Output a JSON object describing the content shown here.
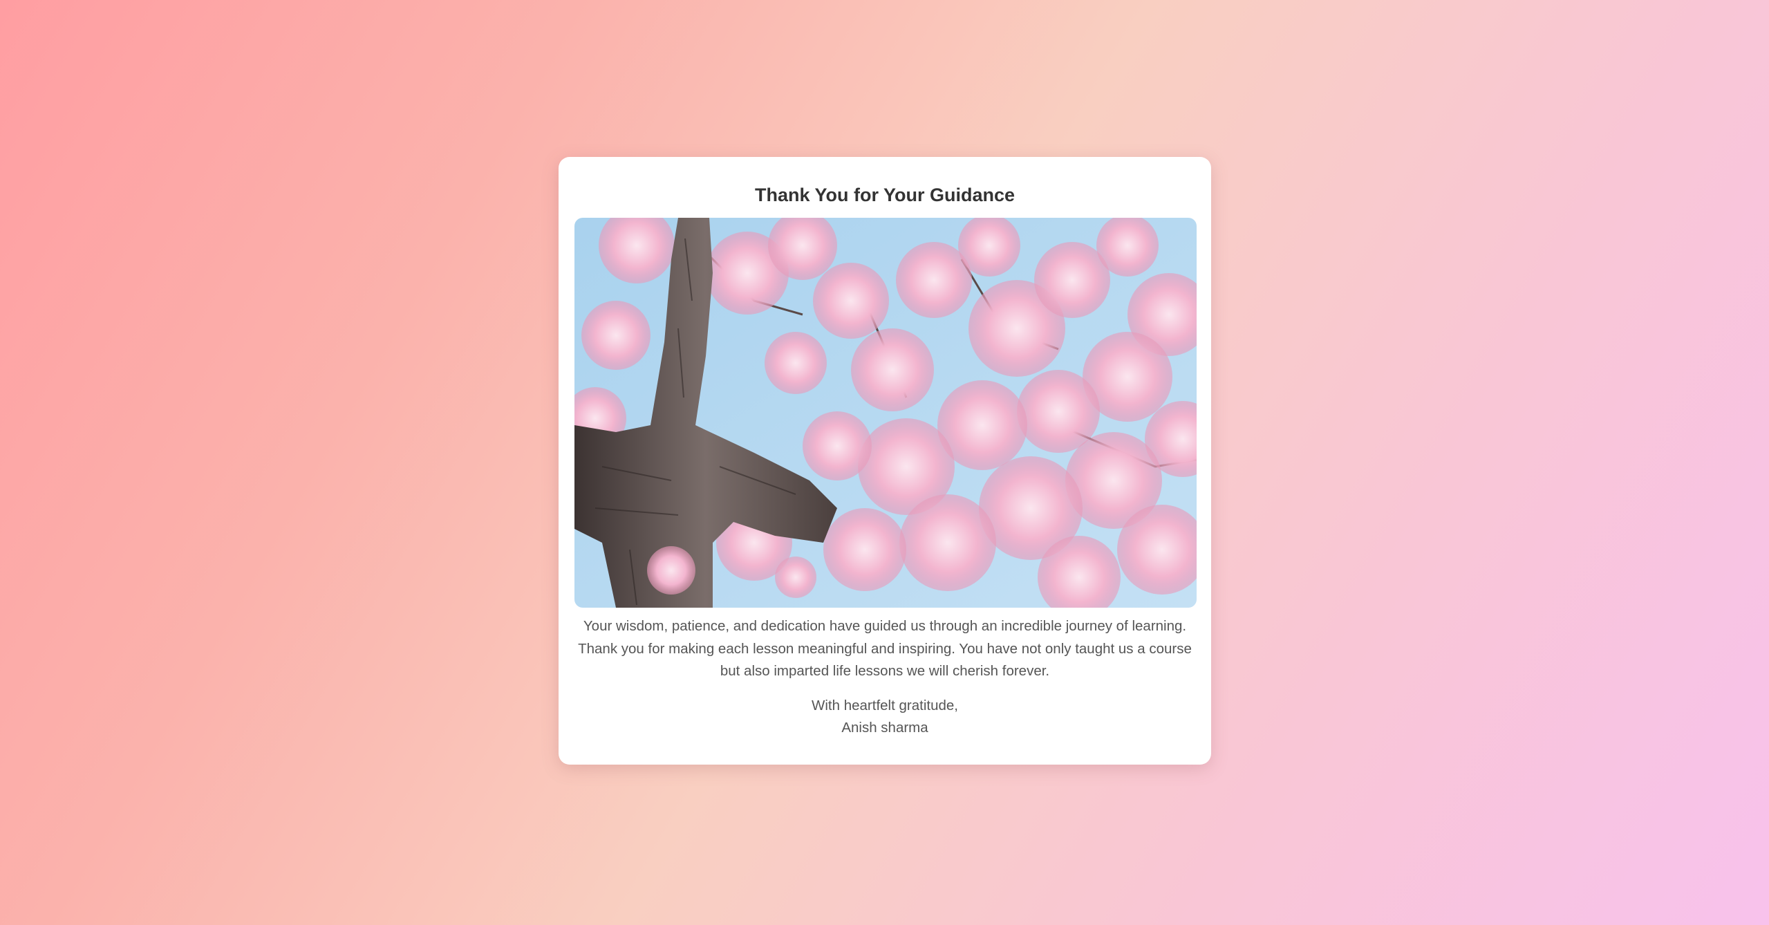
{
  "card": {
    "title": "Thank You for Your Guidance",
    "image": {
      "subject": "cherry-blossom-tree-photo"
    },
    "message": "Your wisdom, patience, and dedication have guided us through an incredible journey of learning. Thank you for making each lesson meaningful and inspiring. You have not only taught us a course but also imparted life lessons we will cherish forever.",
    "closing": "With heartfelt gratitude,",
    "signature": "Anish sharma"
  },
  "colors": {
    "background_start": "#ff9ea2",
    "background_end": "#f8c2ec",
    "card": "#ffffff",
    "title_text": "#333333",
    "body_text": "#555555"
  }
}
